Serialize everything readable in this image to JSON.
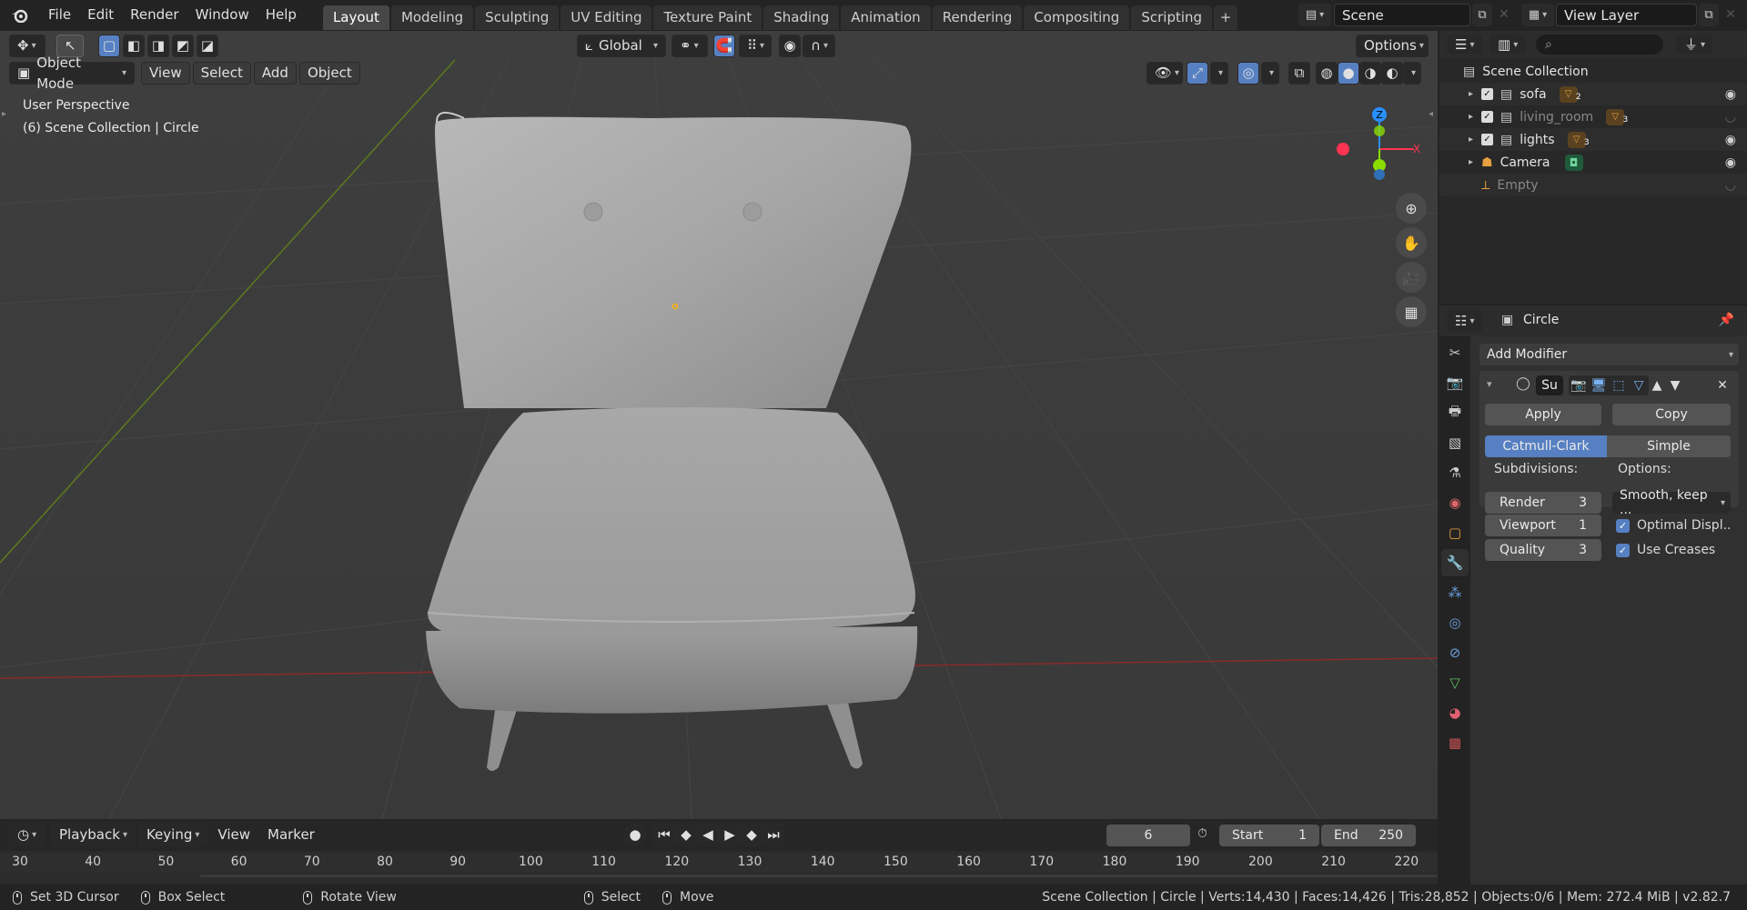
{
  "menu": [
    "File",
    "Edit",
    "Render",
    "Window",
    "Help"
  ],
  "workspace_tabs": [
    {
      "label": "Layout",
      "active": true
    },
    {
      "label": "Modeling",
      "active": false
    },
    {
      "label": "Sculpting",
      "active": false
    },
    {
      "label": "UV Editing",
      "active": false
    },
    {
      "label": "Texture Paint",
      "active": false
    },
    {
      "label": "Shading",
      "active": false
    },
    {
      "label": "Animation",
      "active": false
    },
    {
      "label": "Rendering",
      "active": false
    },
    {
      "label": "Compositing",
      "active": false
    },
    {
      "label": "Scripting",
      "active": false
    }
  ],
  "scene": {
    "name": "Scene",
    "view_layer": "View Layer"
  },
  "viewport": {
    "transform_orientation": "Global",
    "options_label": "Options",
    "mode": "Object Mode",
    "header_menus": [
      "View",
      "Select",
      "Add",
      "Object"
    ],
    "overlay_line1": "User Perspective",
    "overlay_line2": "(6) Scene Collection | Circle",
    "gizmo_axes": {
      "z": "Z",
      "x": "X"
    }
  },
  "outliner": {
    "root": "Scene Collection",
    "items": [
      {
        "label": "sofa",
        "badge": "2",
        "enabled": true,
        "visible": true
      },
      {
        "label": "living_room",
        "badge": "3",
        "enabled": true,
        "visible": false
      },
      {
        "label": "lights",
        "badge": "3",
        "enabled": true,
        "visible": true
      },
      {
        "label": "Camera",
        "badge": "",
        "enabled": true,
        "visible": true
      },
      {
        "label": "Empty",
        "badge": "",
        "enabled": true,
        "visible": false
      }
    ]
  },
  "properties": {
    "object_name": "Circle",
    "add_modifier": "Add Modifier",
    "modifier_name": "Su",
    "apply": "Apply",
    "copy": "Copy",
    "algo_catmull": "Catmull-Clark",
    "algo_simple": "Simple",
    "subdivisions_label": "Subdivisions:",
    "options_label": "Options:",
    "render_label": "Render",
    "render_value": "3",
    "viewport_label": "Viewport",
    "viewport_value": "1",
    "quality_label": "Quality",
    "quality_value": "3",
    "uv_smooth": "Smooth, keep ...",
    "optimal_display": "Optimal Displ..",
    "use_creases": "Use Creases"
  },
  "timeline": {
    "menus": [
      "Playback",
      "Keying",
      "View",
      "Marker"
    ],
    "current_frame": "6",
    "start_label": "Start",
    "start_value": "1",
    "end_label": "End",
    "end_value": "250",
    "ruler": [
      "30",
      "40",
      "50",
      "60",
      "70",
      "80",
      "90",
      "100",
      "110",
      "120",
      "130",
      "140",
      "150",
      "160",
      "170",
      "180",
      "190",
      "200",
      "210",
      "220"
    ]
  },
  "status": {
    "hint1": "Set 3D Cursor",
    "hint2": "Box Select",
    "hint3": "Rotate View",
    "hint4": "Select",
    "hint5": "Move",
    "stats": "Scene Collection | Circle | Verts:14,430 | Faces:14,426 | Tris:28,852 | Objects:0/6 | Mem: 272.4 MiB | v2.82.7"
  },
  "colors": {
    "accent": "#5680c2",
    "x_axis": "#ff3352",
    "y_axis": "#8bdc00",
    "z_axis": "#2890ff"
  }
}
